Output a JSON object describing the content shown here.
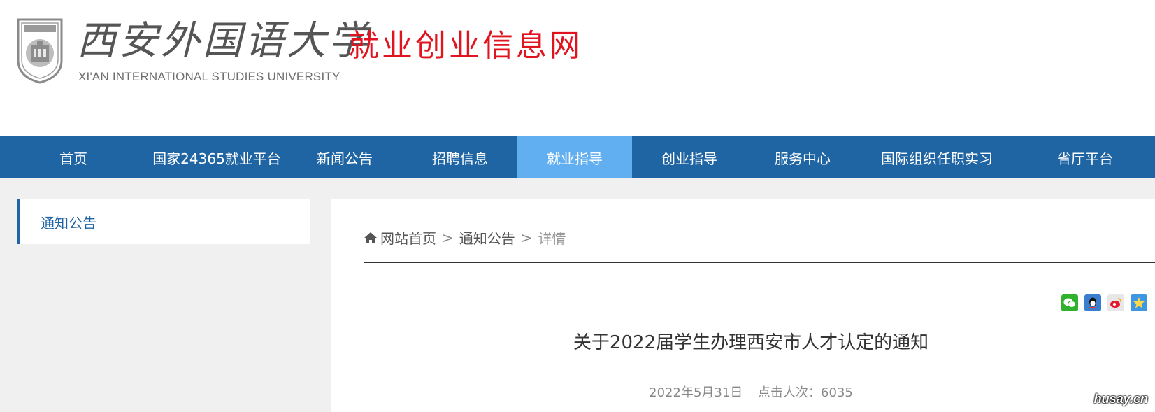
{
  "header": {
    "logo_cn": "西安外国语大学",
    "logo_en": "XI'AN INTERNATIONAL STUDIES UNIVERSITY",
    "site_name": "就业创业信息网"
  },
  "nav": {
    "items": [
      {
        "label": "首页"
      },
      {
        "label": "国家24365就业平台"
      },
      {
        "label": "新闻公告"
      },
      {
        "label": "招聘信息"
      },
      {
        "label": "就业指导"
      },
      {
        "label": "创业指导"
      },
      {
        "label": "服务中心"
      },
      {
        "label": "国际组织任职实习"
      },
      {
        "label": "省厅平台"
      }
    ],
    "active_index": 4
  },
  "sidebar": {
    "section_label": "通知公告"
  },
  "breadcrumb": {
    "home": "网站首页",
    "section": "通知公告",
    "current": "详情",
    "separator": ">"
  },
  "share_icons": [
    "wechat-icon",
    "qq-icon",
    "weibo-icon",
    "qzone-icon"
  ],
  "article": {
    "title": "关于2022届学生办理西安市人才认定的通知",
    "date": "2022年5月31日",
    "views_label": "点击人次：6035"
  },
  "watermark": "husay.cn",
  "colors": {
    "nav_bg": "#1f65a3",
    "nav_active": "#61aff0",
    "brand_red": "#e0141e"
  }
}
